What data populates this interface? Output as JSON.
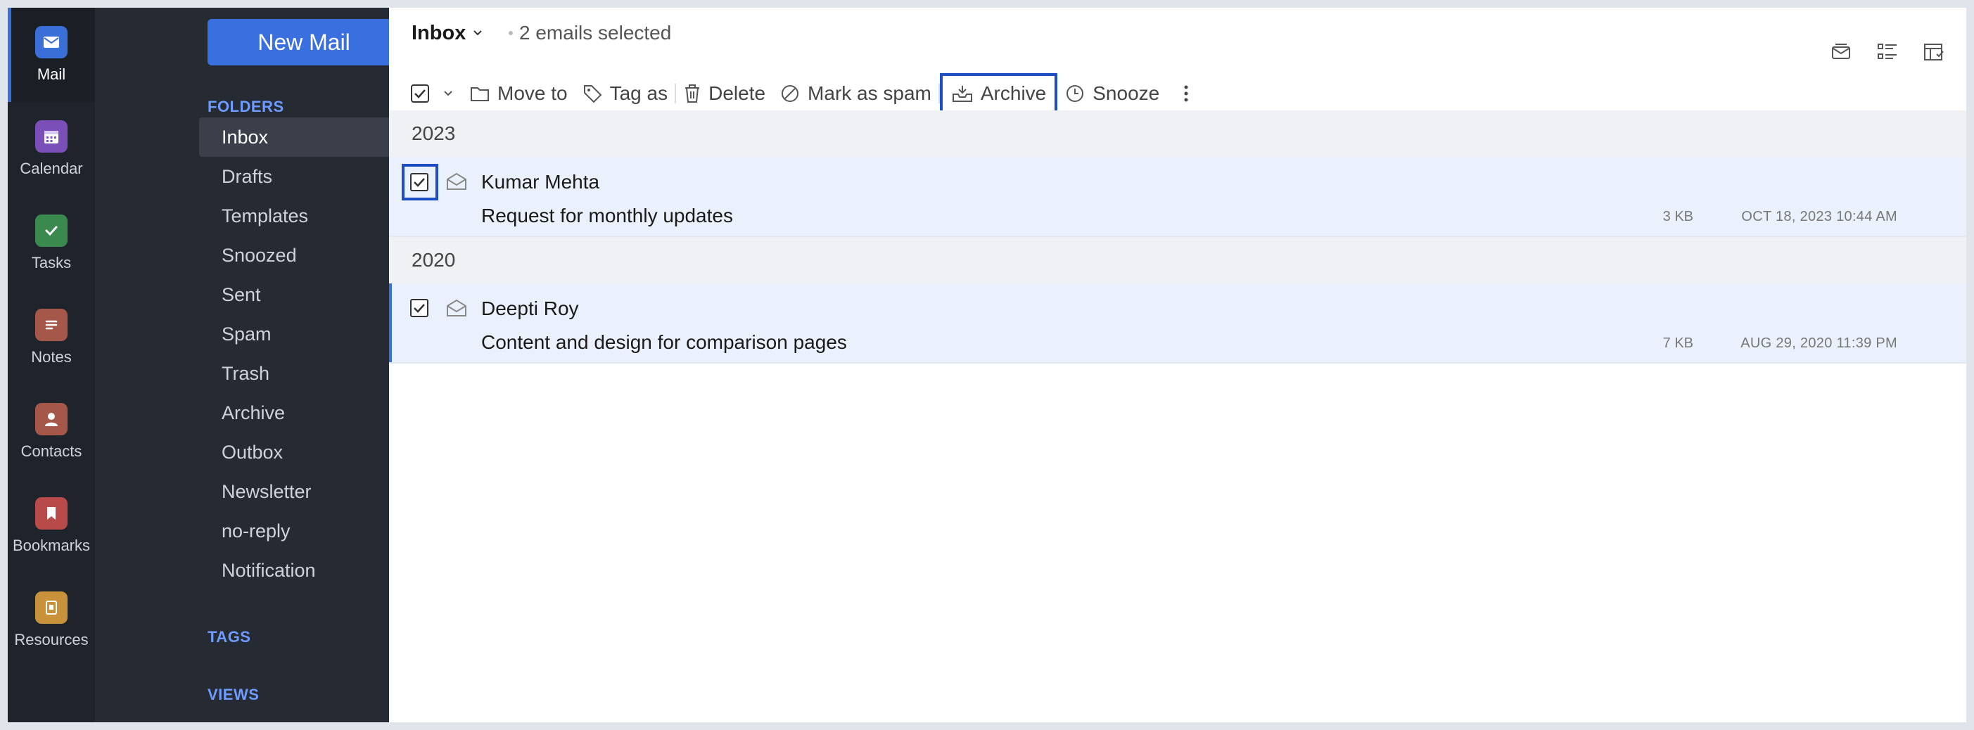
{
  "rail": {
    "items": [
      {
        "label": "Mail",
        "color": "#3b6fd8",
        "icon": "mail-icon"
      },
      {
        "label": "Calendar",
        "color": "#7b4fb8",
        "icon": "calendar-icon"
      },
      {
        "label": "Tasks",
        "color": "#3a8a4f",
        "icon": "check-icon"
      },
      {
        "label": "Notes",
        "color": "#a5574a",
        "icon": "notes-icon"
      },
      {
        "label": "Contacts",
        "color": "#a5574a",
        "icon": "contact-icon"
      },
      {
        "label": "Bookmarks",
        "color": "#b84a4a",
        "icon": "bookmark-icon"
      },
      {
        "label": "Resources",
        "color": "#c8923a",
        "icon": "resources-icon"
      }
    ]
  },
  "folders_pane": {
    "new_mail_label": "New Mail",
    "folders_heading": "FOLDERS",
    "tags_heading": "TAGS",
    "views_heading": "VIEWS",
    "folders": [
      {
        "label": "Inbox",
        "active": true
      },
      {
        "label": "Drafts"
      },
      {
        "label": "Templates"
      },
      {
        "label": "Snoozed"
      },
      {
        "label": "Sent"
      },
      {
        "label": "Spam"
      },
      {
        "label": "Trash"
      },
      {
        "label": "Archive"
      },
      {
        "label": "Outbox"
      },
      {
        "label": "Newsletter"
      },
      {
        "label": "no-reply"
      },
      {
        "label": "Notification"
      }
    ]
  },
  "header": {
    "folder_title": "Inbox",
    "selection_text": "2 emails selected"
  },
  "toolbar": {
    "move_to": "Move to",
    "tag_as": "Tag as",
    "delete": "Delete",
    "mark_as_spam": "Mark as spam",
    "archive": "Archive",
    "snooze": "Snooze"
  },
  "groups": [
    {
      "year": "2023",
      "emails": [
        {
          "sender": "Kumar Mehta",
          "subject": "Request for monthly updates",
          "size": "3 KB",
          "date": "OCT 18, 2023 10:44 AM",
          "selected": true
        }
      ]
    },
    {
      "year": "2020",
      "emails": [
        {
          "sender": "Deepti Roy",
          "subject": "Content and design for comparison pages",
          "size": "7 KB",
          "date": "AUG 29, 2020 11:39 PM",
          "selected": true
        }
      ]
    }
  ]
}
